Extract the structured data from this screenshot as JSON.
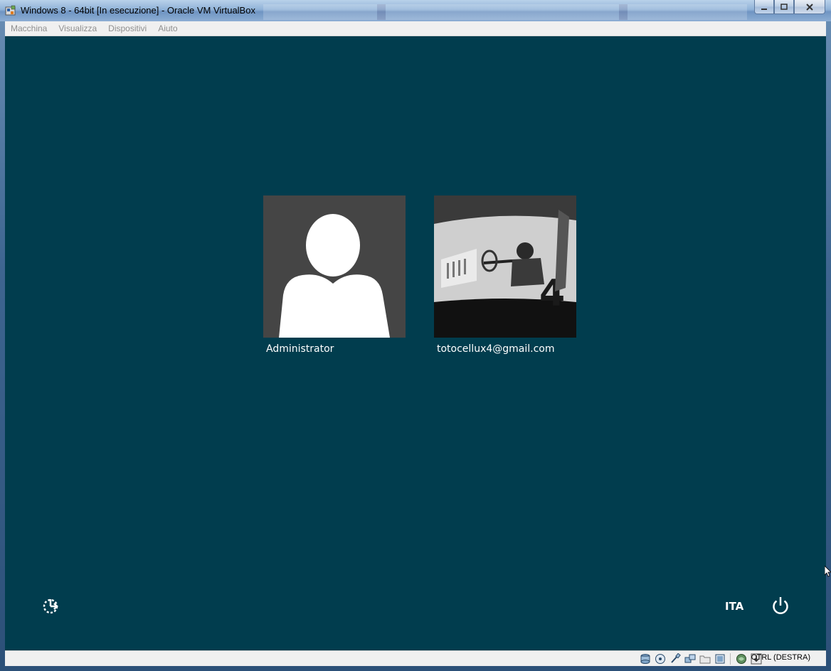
{
  "window": {
    "title": "Windows 8 - 64bit [In esecuzione] - Oracle VM VirtualBox",
    "app_icon": "virtualbox-icon",
    "controls": [
      "minimize-icon",
      "maximize-icon",
      "close-icon"
    ]
  },
  "menubar": {
    "items": [
      "Macchina",
      "Visualizza",
      "Dispositivi",
      "Aiuto"
    ]
  },
  "lockscreen": {
    "background_color": "#013d4e",
    "users": [
      {
        "name": "Administrator",
        "picture": "default-user-icon"
      },
      {
        "name": "totocellux4@gmail.com",
        "picture": "race-car-driver-photo"
      }
    ],
    "ease_of_access_icon": "ease-of-access-icon",
    "language": "ITA",
    "power_icon": "power-icon"
  },
  "statusbar": {
    "icons": [
      "hard-disk-icon",
      "optical-drive-icon",
      "usb-icon",
      "network-icon",
      "shared-folders-icon",
      "display-icon",
      "recording-icon",
      "mouse-integration-icon"
    ],
    "host_key": "CTRL (DESTRA)"
  }
}
